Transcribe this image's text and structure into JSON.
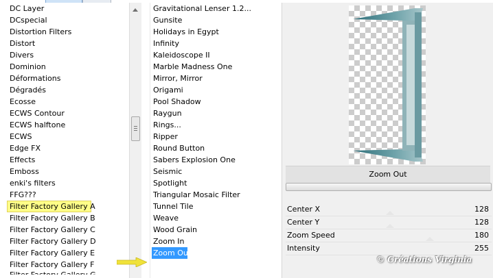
{
  "categories": {
    "items": [
      "DC Layer",
      "DCspecial",
      "Distortion Filters",
      "Distort",
      "Divers",
      "Dominion",
      "Déformations",
      "Dégradés",
      "Ecosse",
      "ECWS Contour",
      "ECWS halftone",
      "ECWS",
      "Edge FX",
      "Effects",
      "Emboss",
      "enki's filters",
      "FFG???",
      "Filter Factory Gallery A",
      "Filter Factory Gallery B",
      "Filter Factory Gallery C",
      "Filter Factory Gallery D",
      "Filter Factory Gallery E",
      "Filter Factory Gallery F",
      "Filter Factory Gallery G"
    ],
    "highlighted": "Filter Factory Gallery A"
  },
  "filters": {
    "items": [
      "Gravitational Lenser 1.2...",
      "Gunsite",
      "Holidays in Egypt",
      "Infinity",
      "Kaleidoscope II",
      "Marble Madness One",
      "Mirror, Mirror",
      "Origami",
      "Pool Shadow",
      "Raygun",
      "Rings...",
      "Ripper",
      "Round Button",
      "Sabers Explosion One",
      "Seismic",
      "Spotlight",
      "Triangular Mosaic Filter",
      "Tunnel Tile",
      "Weave",
      "Wood Grain",
      "Zoom In",
      "Zoom Out"
    ],
    "selected": "Zoom Out"
  },
  "preview": {
    "filter_name": "Zoom Out"
  },
  "params": [
    {
      "name": "Center X",
      "value": "128"
    },
    {
      "name": "Center Y",
      "value": "128"
    },
    {
      "name": "Zoom Speed",
      "value": "180"
    },
    {
      "name": "Intensity",
      "value": "255"
    }
  ],
  "watermark": "© Créations Virginia",
  "colors": {
    "selection": "#3399ff",
    "highlight": "#ffff88",
    "arrow": "#f0e23a",
    "frame": "#4a8a92"
  }
}
